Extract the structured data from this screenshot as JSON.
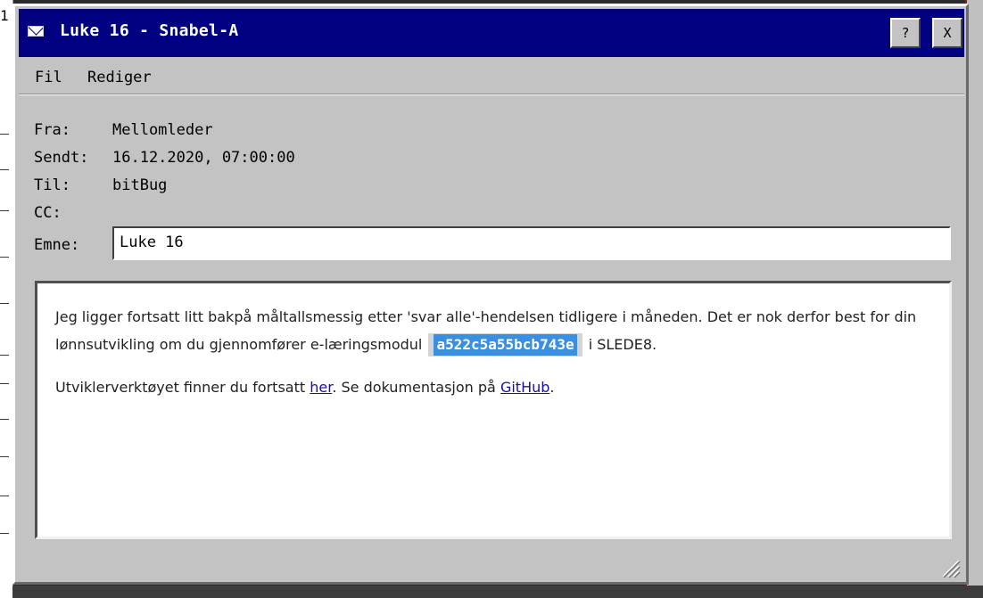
{
  "desktop": {
    "left_fragment": "1"
  },
  "window": {
    "title": "Luke 16 - Snabel-A",
    "title_icon": "envelope-icon",
    "help_label": "?",
    "close_label": "X"
  },
  "menu": {
    "file": "Fil",
    "edit": "Rediger"
  },
  "headers": {
    "from_label": "Fra:",
    "from_value": "Mellomleder",
    "sent_label": "Sendt:",
    "sent_value": "16.12.2020, 07:00:00",
    "to_label": "Til:",
    "to_value": "bitBug",
    "cc_label": "CC:",
    "cc_value": "",
    "subject_label": "Emne:",
    "subject_value": "Luke 16"
  },
  "message": {
    "p1_part1": "Jeg ligger fortsatt litt bakpå måltallsmessig etter 'svar alle'-hendelsen tidligere i måneden. Det er nok derfor best for din lønnsutvikling om du gjennomfører e-læringsmodul",
    "code": "a522c5a55bcb743e",
    "p1_part2": "i SLEDE8.",
    "p2_part1": "Utviklerverktøyet finner du fortsatt",
    "link_here": "her",
    "p2_part2": ". Se dokumentasjon på",
    "link_github": "GitHub",
    "p2_part3": "."
  },
  "colors": {
    "titlebar": "#000080",
    "window": "#c3c3c3",
    "code_highlight": "#3a8fe0",
    "link": "#1a0dab"
  }
}
